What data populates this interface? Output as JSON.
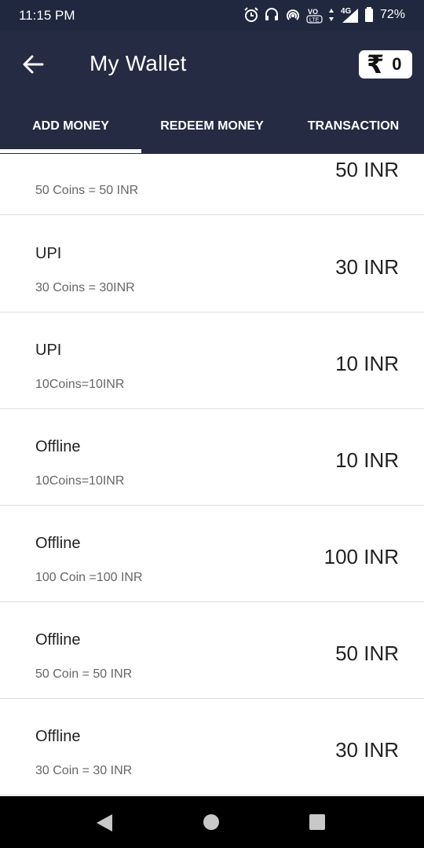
{
  "status_bar": {
    "time": "11:15 PM",
    "network": "4G",
    "volte": "VO LTE",
    "battery": "72%"
  },
  "header": {
    "title": "My Wallet",
    "currency_symbol": "₹",
    "balance": "0"
  },
  "tabs": [
    {
      "label": "ADD MONEY",
      "active": true
    },
    {
      "label": "REDEEM MONEY",
      "active": false
    },
    {
      "label": "TRANSACTION",
      "active": false
    }
  ],
  "items": [
    {
      "method": "",
      "desc": "50 Coins = 50 INR",
      "price": "50 INR"
    },
    {
      "method": "UPI",
      "desc": "30 Coins = 30INR",
      "price": "30 INR"
    },
    {
      "method": "UPI",
      "desc": "10Coins=10INR",
      "price": "10 INR"
    },
    {
      "method": "Offline",
      "desc": "10Coins=10INR",
      "price": "10 INR"
    },
    {
      "method": "Offline",
      "desc": "100 Coin =100 INR",
      "price": "100 INR"
    },
    {
      "method": "Offline",
      "desc": "50 Coin = 50 INR",
      "price": "50 INR"
    },
    {
      "method": "Offline",
      "desc": "30 Coin = 30 INR",
      "price": "30 INR"
    }
  ],
  "colors": {
    "header_bg": "#252b42",
    "status_bg": "#202840",
    "divider": "#e0e0e0"
  }
}
